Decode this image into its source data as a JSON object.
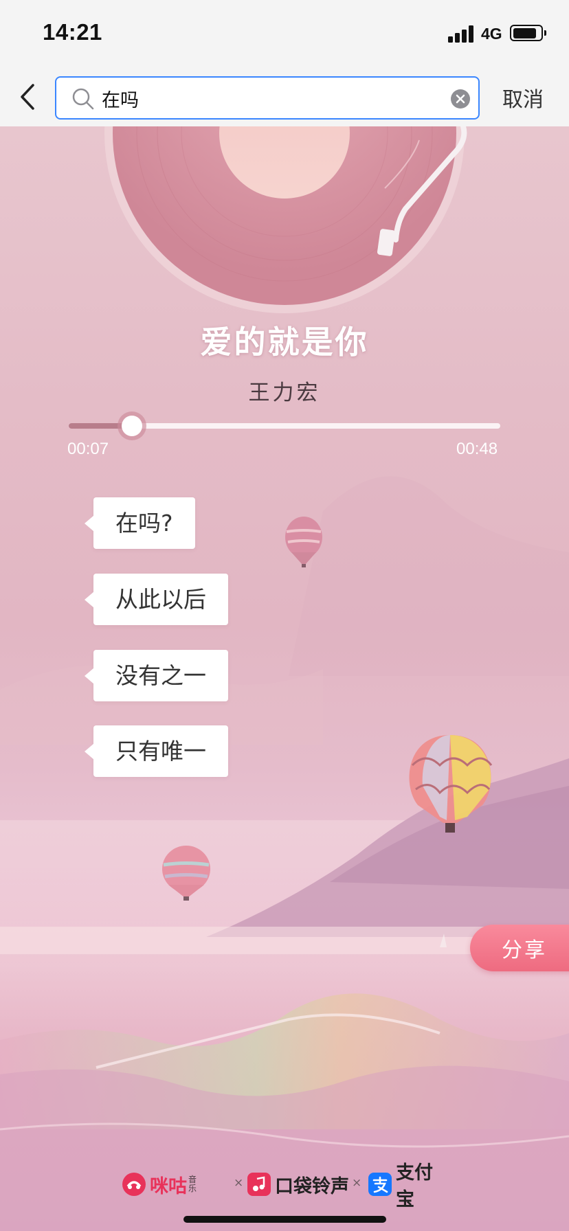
{
  "status_bar": {
    "time": "14:21",
    "network": "4G",
    "signal_bars": 4,
    "battery_level": 0.85
  },
  "search": {
    "back_icon": "chevron-left-icon",
    "value": "在吗",
    "cancel_label": "取消"
  },
  "player": {
    "title": "爱的就是你",
    "artist": "王力宏",
    "elapsed": "00:07",
    "total": "00:48",
    "progress": 0.146
  },
  "lyrics": [
    "在吗?",
    "从此以后",
    "没有之一",
    "只有唯一"
  ],
  "share_label": "分享",
  "partners": [
    {
      "name": "咪咕",
      "sub": "音乐",
      "color": "#e8325a"
    },
    {
      "name": "口袋铃声",
      "color": "#e8325a"
    },
    {
      "name": "支付宝",
      "color": "#1677ff"
    }
  ],
  "partner_separator": "×",
  "colors": {
    "accent": "#3a86ff",
    "share": "#ee6b80",
    "migu": "#e8325a",
    "alipay": "#1677ff"
  }
}
